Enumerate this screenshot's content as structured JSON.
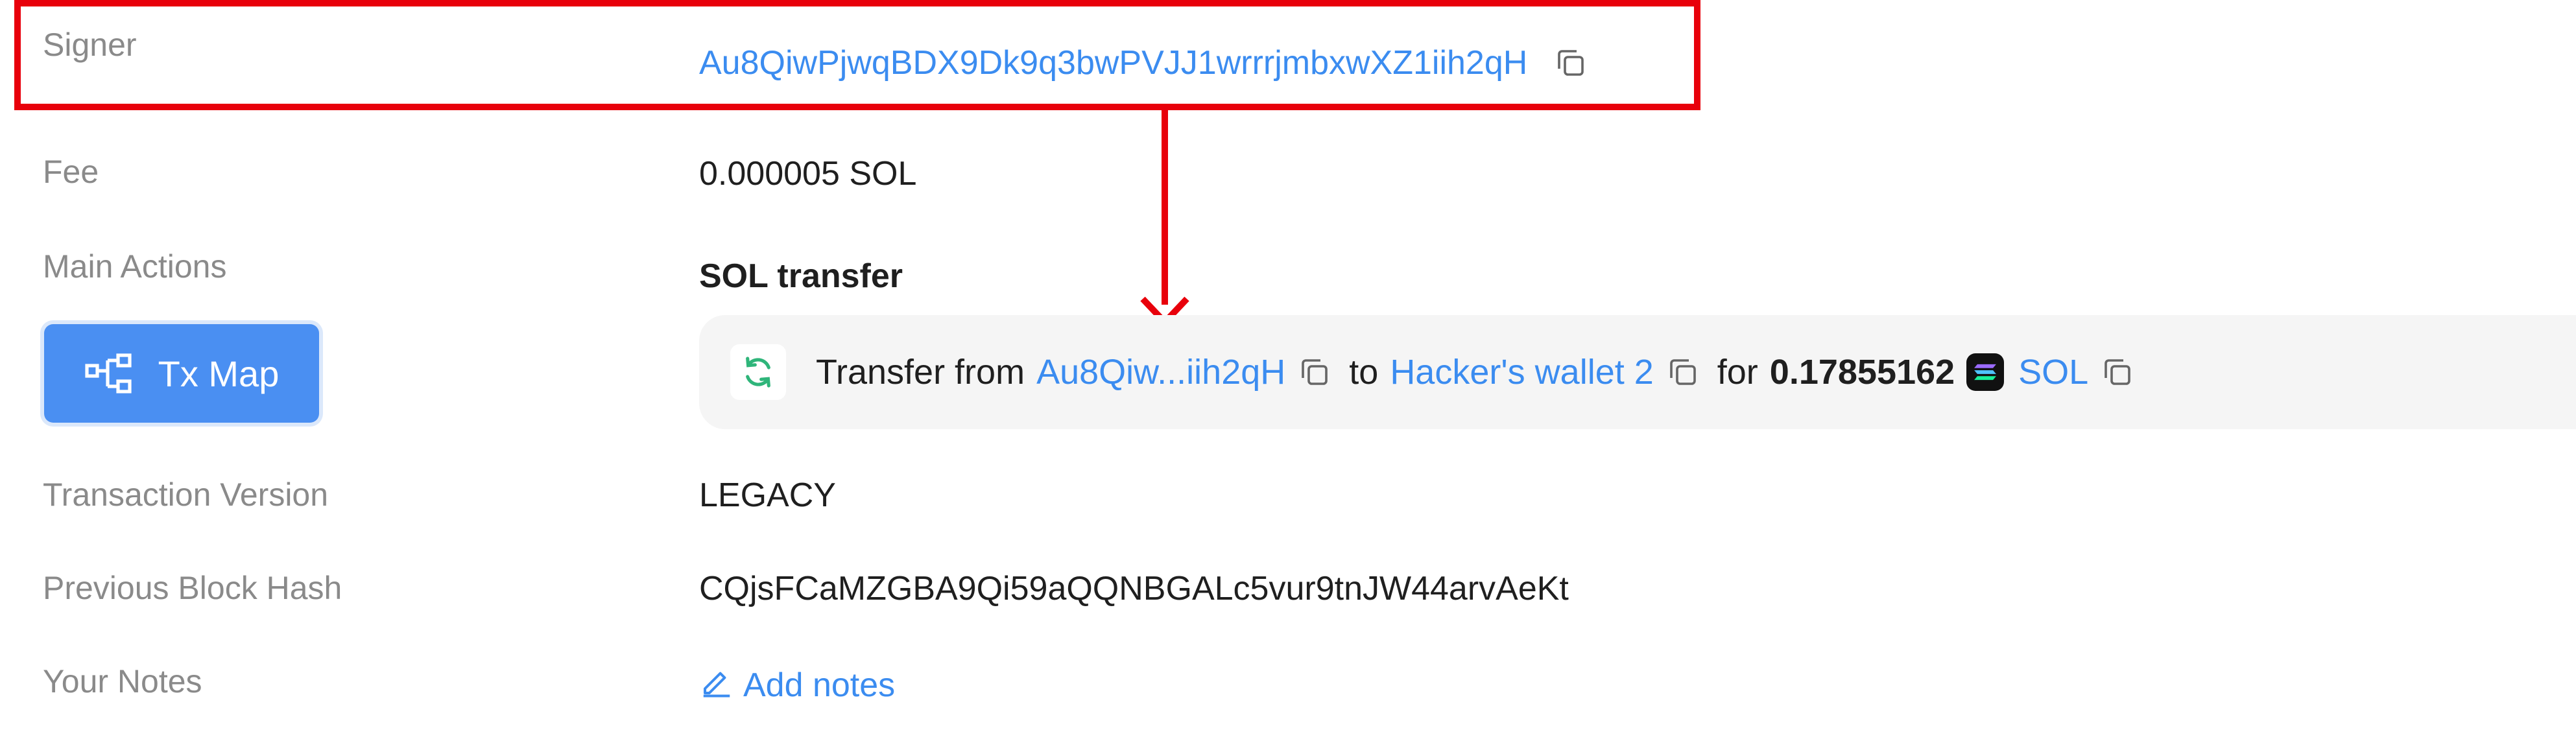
{
  "rows": {
    "signer": {
      "label": "Signer",
      "address": "Au8QiwPjwqBDX9Dk9q3bwPVJJ1wrrrjmbxwXZ1iih2qH"
    },
    "fee": {
      "label": "Fee",
      "value": "0.000005 SOL"
    },
    "main_actions": {
      "label": "Main Actions",
      "title": "SOL transfer"
    },
    "tx_map": {
      "button_label": "Tx Map"
    },
    "transfer": {
      "prefix": "Transfer from",
      "from": "Au8Qiw...iih2qH",
      "to_word": "to",
      "to": "Hacker's wallet 2",
      "for_word": "for",
      "amount": "0.17855162",
      "token": "SOL"
    },
    "transaction_version": {
      "label": "Transaction Version",
      "value": "LEGACY"
    },
    "previous_block_hash": {
      "label": "Previous Block Hash",
      "value": "CQjsFCaMZGBA9Qi59aQQNBGALc5vur9tnJW44arvAeKt"
    },
    "your_notes": {
      "label": "Your Notes",
      "action": "Add notes"
    }
  },
  "annotation": {
    "color": "#e8000b"
  },
  "colors": {
    "link": "#3b8cf0",
    "label": "#8a8a8a",
    "button": "#4a8ff2",
    "panel": "#f5f5f5",
    "refresh": "#2fb57a"
  },
  "icons": [
    "copy-icon",
    "refresh-icon",
    "tx-map-icon",
    "sol-token-icon",
    "pencil-icon",
    "arrow-down-icon"
  ]
}
